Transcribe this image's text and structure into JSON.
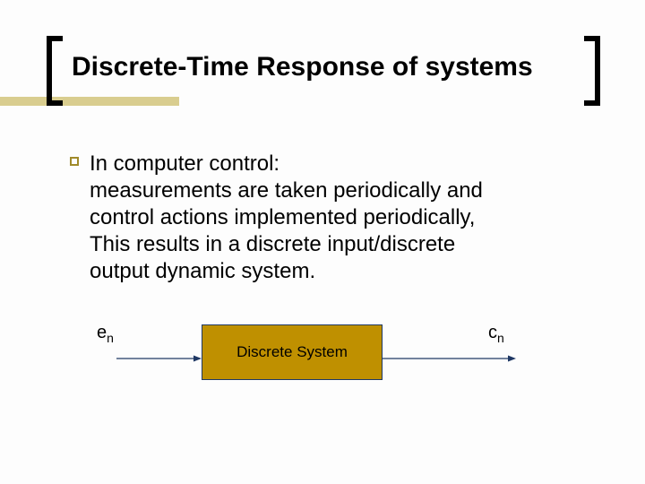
{
  "title": "Discrete-Time Response of systems",
  "body": {
    "line1": "In computer control:",
    "line2": "measurements are taken periodically and",
    "line3": "control actions implemented periodically,",
    "line4": "This results in a discrete input/discrete",
    "line5": "output dynamic system."
  },
  "diagram": {
    "input_symbol": "e",
    "input_sub": "n",
    "block_label": "Discrete System",
    "output_symbol": "c",
    "output_sub": "n"
  }
}
